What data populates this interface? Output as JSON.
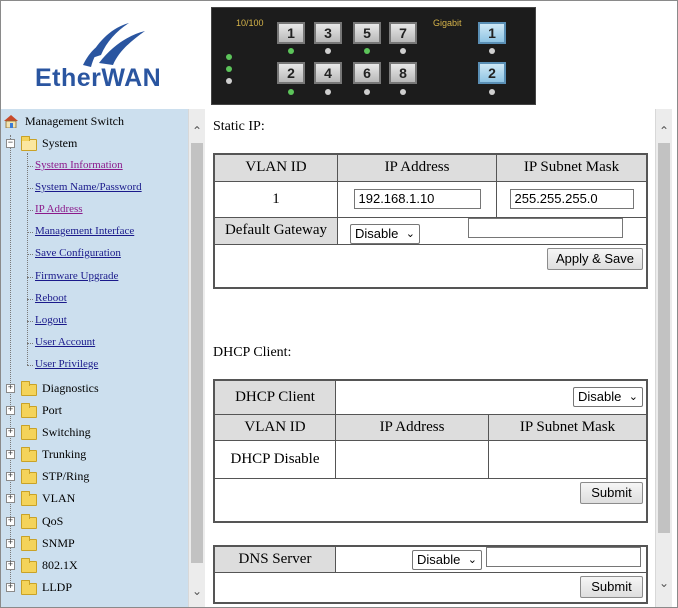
{
  "brand": {
    "name": "EtherWAN"
  },
  "panel": {
    "label_fast": "10/100",
    "label_giga": "Gigabit",
    "ports_top": [
      "1",
      "3",
      "5",
      "7"
    ],
    "ports_bottom": [
      "2",
      "4",
      "6",
      "8"
    ],
    "giga_top": "1",
    "giga_bottom": "2",
    "colors": {
      "led_on": "#5cc45a",
      "led_off": "#cfcfcf",
      "label": "#d6b44a"
    }
  },
  "sidebar": {
    "root": "Management Switch",
    "system": "System",
    "system_items": [
      "System Information",
      "System Name/Password",
      "IP Address",
      "Management Interface",
      "Save Configuration",
      "Firmware Upgrade",
      "Reboot",
      "Logout",
      "User Account",
      "User Privilege"
    ],
    "folders": [
      "Diagnostics",
      "Port",
      "Switching",
      "Trunking",
      "STP/Ring",
      "VLAN",
      "QoS",
      "SNMP",
      "802.1X",
      "LLDP"
    ]
  },
  "static_ip": {
    "title": "Static IP:",
    "headers": [
      "VLAN ID",
      "IP Address",
      "IP Subnet Mask"
    ],
    "vlan_id": "1",
    "ip_address": "192.168.1.10",
    "subnet_mask": "255.255.255.0",
    "gateway_label": "Default Gateway",
    "gateway_select": "Disable",
    "gateway_value": "",
    "apply_label": "Apply & Save"
  },
  "dhcp": {
    "title": "DHCP Client:",
    "client_label": "DHCP Client",
    "client_select": "Disable",
    "headers": [
      "VLAN ID",
      "IP Address",
      "IP Subnet Mask"
    ],
    "status": "DHCP Disable",
    "submit_label": "Submit"
  },
  "dns": {
    "label": "DNS Server",
    "select": "Disable",
    "value": "",
    "submit_label": "Submit"
  }
}
